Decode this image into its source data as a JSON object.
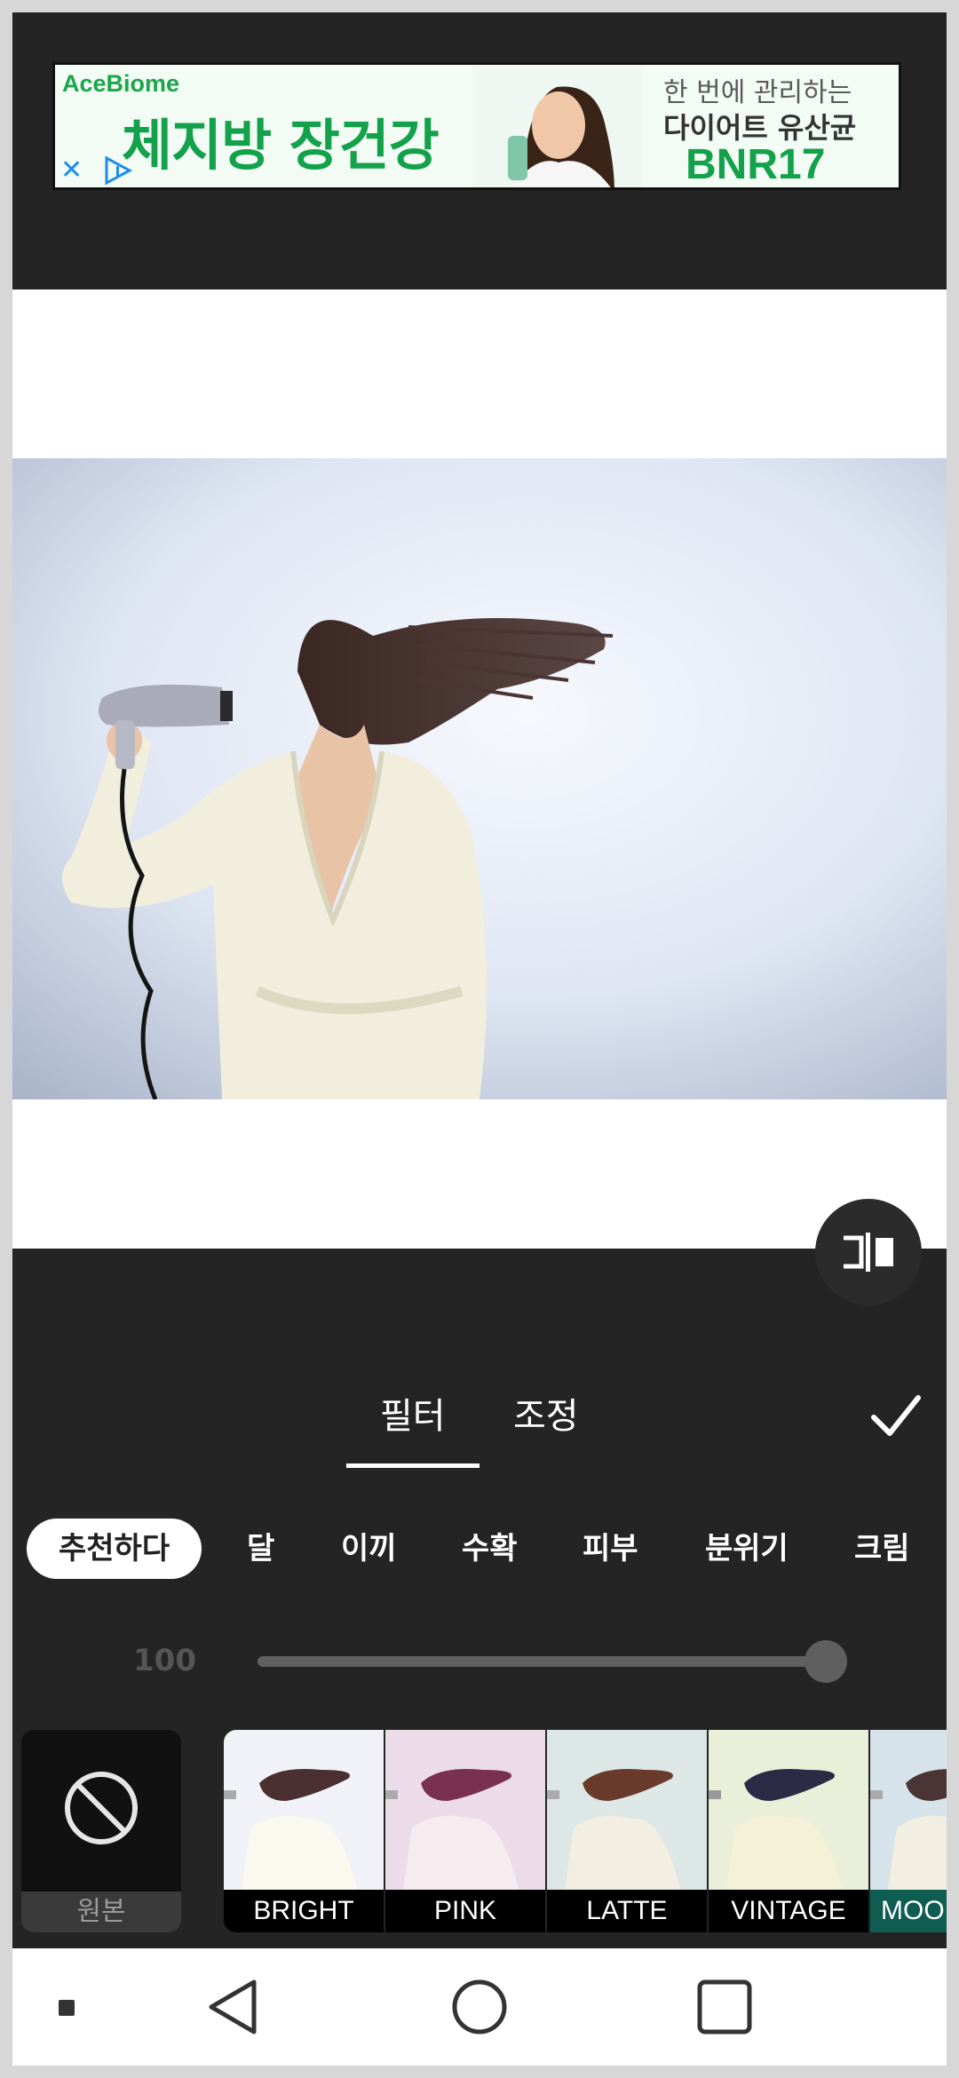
{
  "ad": {
    "brand": "AceBiome",
    "headline": "체지방 장건강",
    "sub1": "한 번에 관리하는",
    "sub2": "다이어트 유산균",
    "sub3": "BNR17",
    "close_icon": "close-icon",
    "info_icon": "adchoices-icon"
  },
  "editor": {
    "tabs": [
      "필터",
      "조정"
    ],
    "active_tab": "필터",
    "categories": [
      "추천하다",
      "달",
      "이끼",
      "수확",
      "피부",
      "분위기",
      "크림"
    ],
    "active_category": "추천하다",
    "intensity": 100,
    "intensity_label": "100",
    "original_label": "원본",
    "filters": [
      "BRIGHT",
      "PINK",
      "LATTE",
      "VINTAGE",
      "MOOD"
    ],
    "selected_filter": "MOOD",
    "colors": {
      "panel": "#242424",
      "accent": "#0f5d52"
    }
  },
  "navbar": {
    "icons": [
      "menu-dot-icon",
      "back-icon",
      "home-icon",
      "recents-icon"
    ]
  }
}
